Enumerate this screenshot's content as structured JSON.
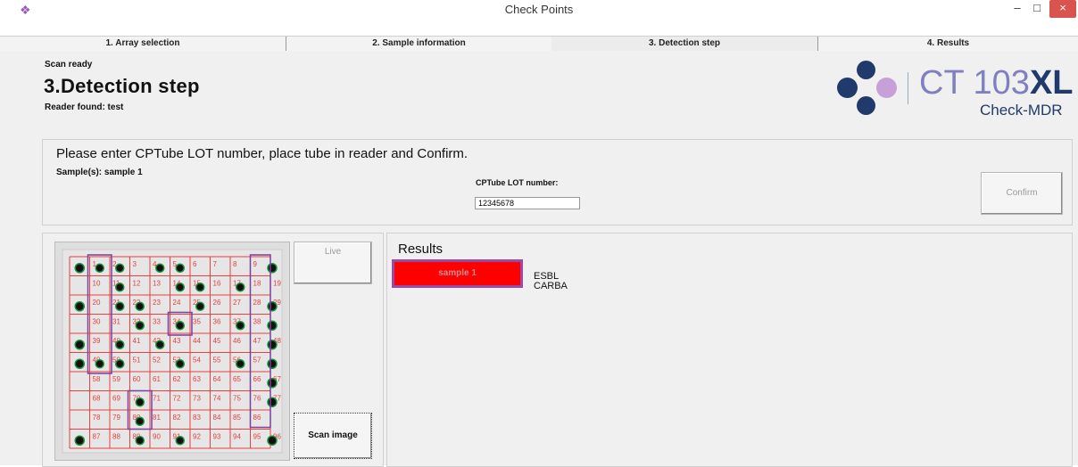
{
  "window": {
    "title": "Check Points",
    "minimize": "–",
    "maximize": "□",
    "close": "×"
  },
  "tabs": [
    {
      "label": "1. Array selection",
      "active": false
    },
    {
      "label": "2. Sample information",
      "active": false
    },
    {
      "label": "3. Detection step",
      "active": true
    },
    {
      "label": "4. Results",
      "active": false
    }
  ],
  "header": {
    "status": "Scan ready",
    "title": "3.Detection step",
    "reader": "Reader found: test"
  },
  "logo": {
    "product": "CT 103",
    "product_suffix": "XL",
    "subtitle": "Check-MDR"
  },
  "lot_panel": {
    "instruction": "Please enter CPTube LOT number, place tube in reader and Confirm.",
    "samples": "Sample(s):   sample 1",
    "lot_label": "CPTube LOT number:",
    "lot_value": "12345678",
    "confirm_label": "Confirm"
  },
  "scan_panel": {
    "live_label": "Live",
    "scan_label": "Scan image"
  },
  "array_image": {
    "numbers": [
      [
        1,
        2,
        3,
        4,
        5,
        6,
        7,
        8,
        9
      ],
      [
        10,
        11,
        12,
        13,
        14,
        15,
        16,
        17,
        18,
        19
      ],
      [
        20,
        21,
        22,
        23,
        24,
        25,
        26,
        27,
        28,
        29
      ],
      [
        30,
        31,
        32,
        33,
        34,
        35,
        36,
        37,
        38
      ],
      [
        39,
        40,
        41,
        42,
        43,
        44,
        45,
        46,
        47,
        48
      ],
      [
        49,
        50,
        51,
        52,
        53,
        54,
        55,
        56,
        57
      ],
      [
        58,
        59,
        60,
        61,
        62,
        63,
        64,
        65,
        66,
        67
      ],
      [
        68,
        69,
        70,
        71,
        72,
        73,
        74,
        75,
        76,
        77
      ],
      [
        78,
        79,
        80,
        81,
        82,
        83,
        84,
        85,
        86
      ],
      [
        87,
        88,
        89,
        90,
        91,
        92,
        93,
        94,
        95,
        96
      ]
    ]
  },
  "results": {
    "title": "Results",
    "sample_button": "sample 1",
    "labels": [
      "ESBL",
      "CARBA"
    ]
  },
  "colors": {
    "grid": "#e84040",
    "highlight": "#7b3fa0",
    "result_fill": "#ff0000",
    "result_border": "#9c4aa8",
    "logo_purple": "#c8a0d8",
    "logo_navy": "#1f3a6b"
  }
}
